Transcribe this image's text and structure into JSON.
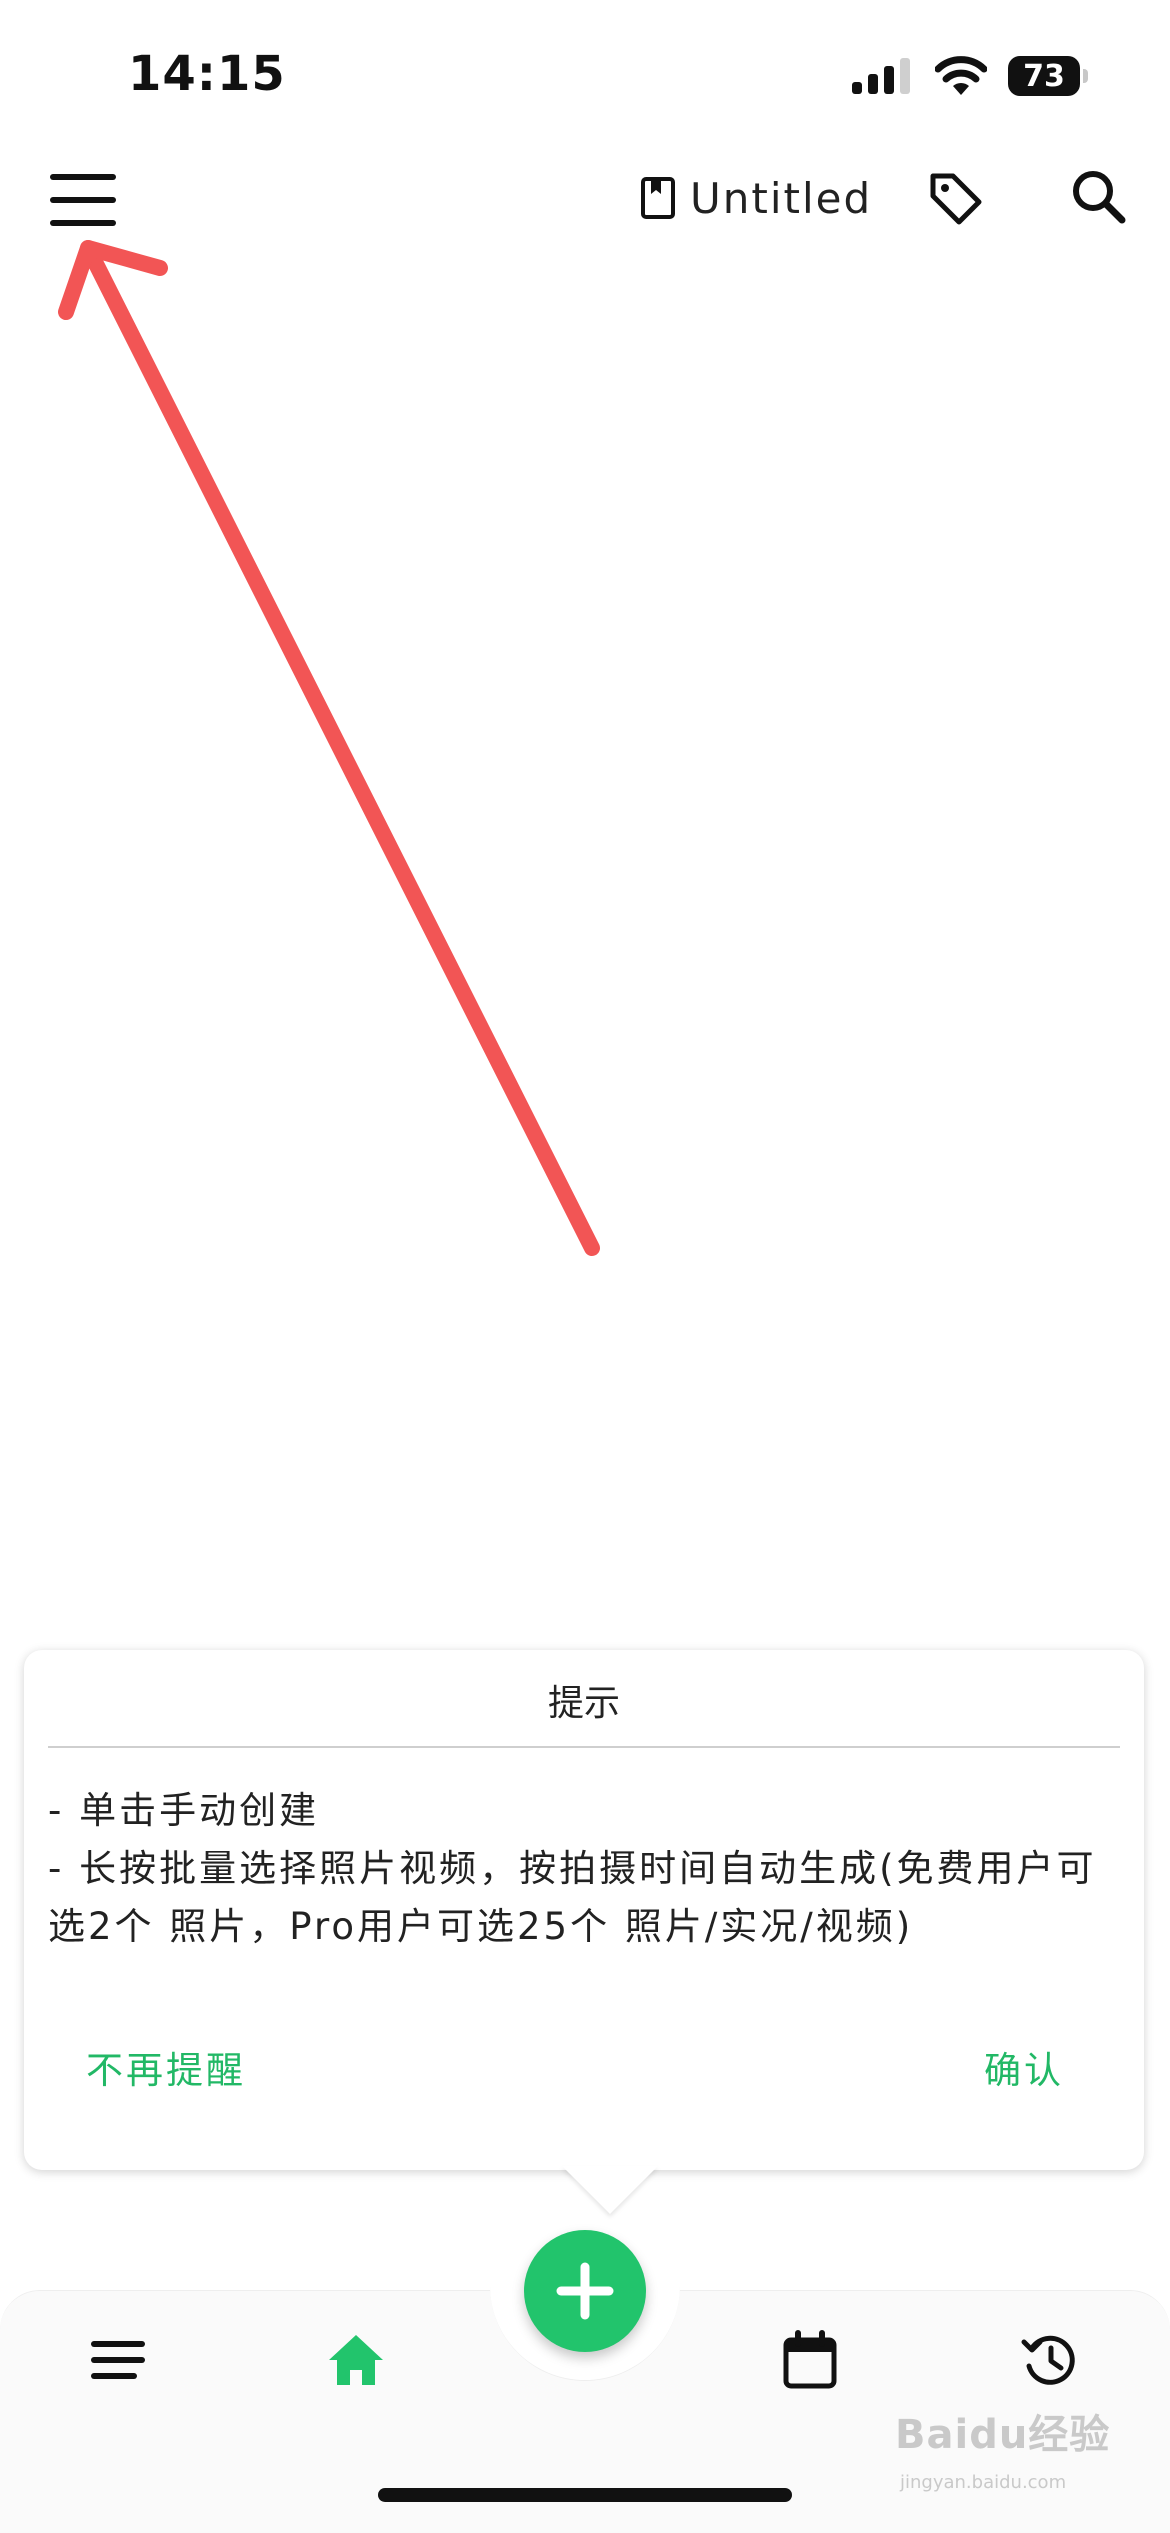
{
  "status_bar": {
    "time": "14:15",
    "battery": "73"
  },
  "header": {
    "notebook_title": "Untitled"
  },
  "tip_dialog": {
    "title": "提示",
    "lines": [
      "- 单击手动创建",
      "- 长按批量选择照片视频，按拍摄时间自动生成(免费用户可",
      "选2个 照片，Pro用户可选25个 照片/实况/视频)"
    ],
    "dismiss_label": "不再提醒",
    "confirm_label": "确认"
  },
  "bottom_nav": {
    "items": [
      "list-icon",
      "home-icon",
      "calendar-icon",
      "history-icon"
    ],
    "active": "home-icon",
    "fab_icon": "plus-icon"
  },
  "watermark": {
    "text": "Baidu经验",
    "sub": "jingyan.baidu.com"
  },
  "colors": {
    "accent": "#22c46c",
    "annotation": "#f25555"
  }
}
